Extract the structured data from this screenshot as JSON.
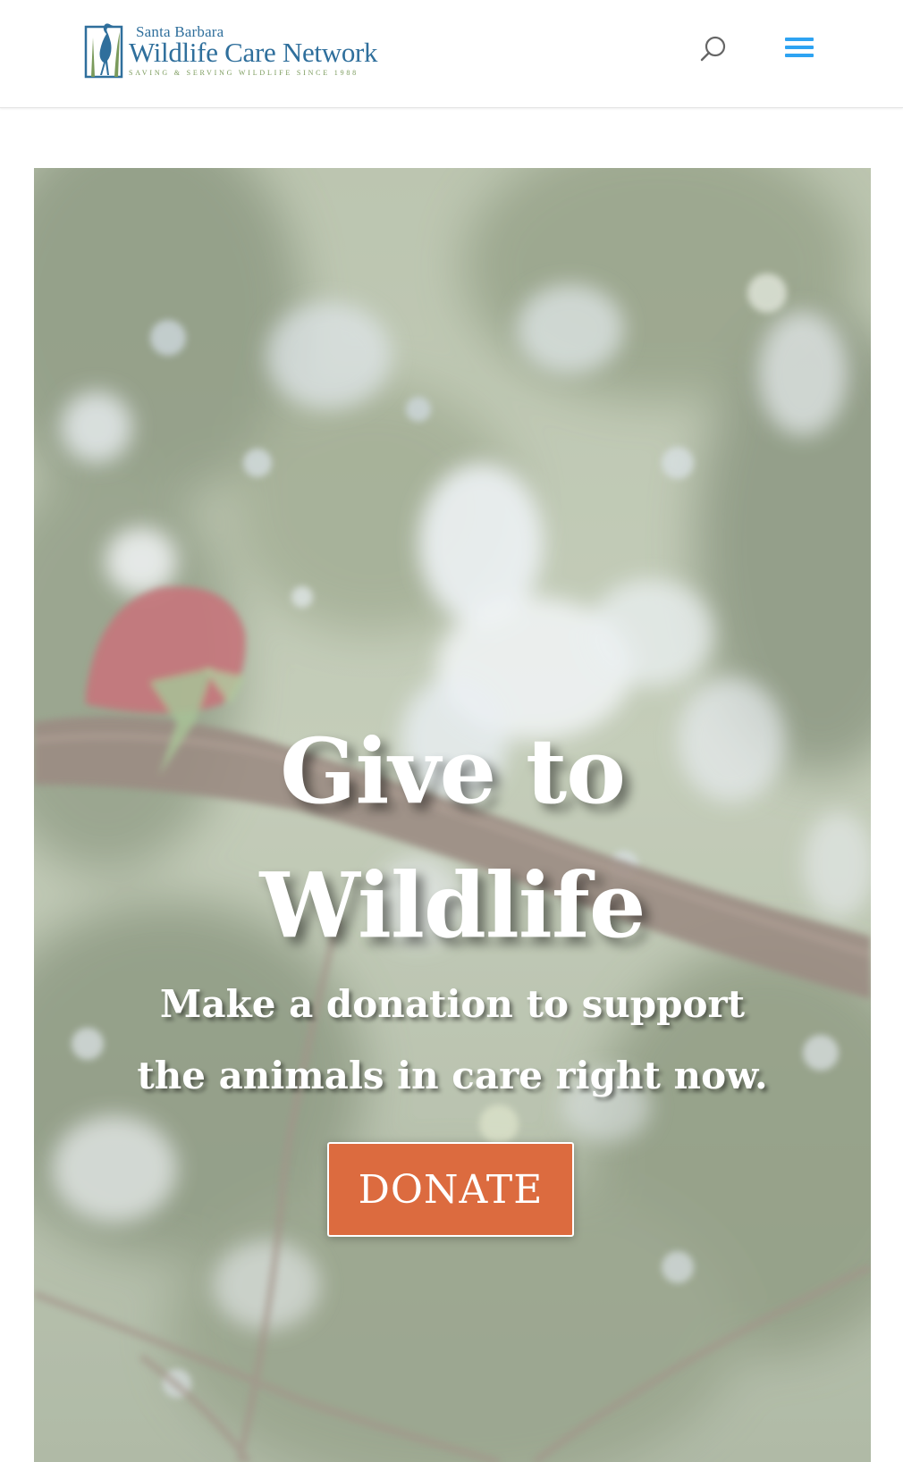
{
  "header": {
    "logo": {
      "line1": "Santa Barbara",
      "line2": "Wildlife Care Network",
      "tagline": "SAVING & SERVING WILDLIFE SINCE 1988",
      "icon": "heron-icon"
    },
    "search_icon": "search-icon",
    "menu_icon": "hamburger-menu-icon"
  },
  "hero": {
    "background": "blurred photo of a red bird on a branch",
    "title_line1": "Give to",
    "title_line2": "Wildlife",
    "subtitle_line1": "Make a donation to support",
    "subtitle_line2": "the animals in care right now.",
    "button_label": "DONATE"
  },
  "colors": {
    "brand_blue": "#2f6f9c",
    "brand_green": "#7a9a5b",
    "menu_blue": "#2ea3f2",
    "donate_orange": "#dc6b3f"
  }
}
